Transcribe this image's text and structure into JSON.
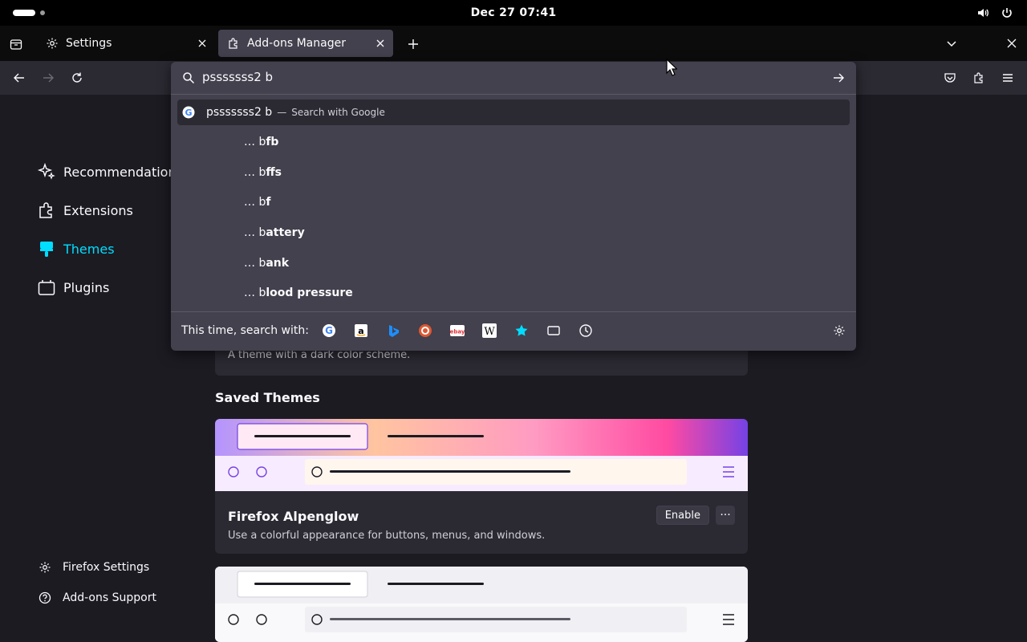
{
  "system": {
    "clock": "Dec 27  07:41",
    "icons": [
      "volume-icon",
      "power-icon"
    ]
  },
  "tabs": [
    {
      "label": "Settings",
      "icon": "gear-icon",
      "active": false
    },
    {
      "label": "Add-ons Manager",
      "icon": "puzzle-icon",
      "active": true
    }
  ],
  "urlbar": {
    "value": "psssssss2 b",
    "top_suggestion": {
      "query": "psssssss2 b",
      "separator": "—",
      "action": "Search with Google"
    },
    "suggestions": [
      {
        "prefix": "… b",
        "bold": "fb"
      },
      {
        "prefix": "… b",
        "bold": "ffs"
      },
      {
        "prefix": "… b",
        "bold": "f"
      },
      {
        "prefix": "… b",
        "bold": "attery"
      },
      {
        "prefix": "… b",
        "bold": "ank"
      },
      {
        "prefix": "… b",
        "bold": "lood pressure"
      }
    ],
    "one_off_label": "This time, search with:",
    "engines": [
      "google-icon",
      "amazon-icon",
      "bing-icon",
      "duckduckgo-icon",
      "ebay-icon",
      "wikipedia-icon",
      "bookmarks-icon",
      "tabs-icon",
      "history-icon"
    ]
  },
  "sidebar": {
    "categories": [
      {
        "label": "Recommendations",
        "icon": "sparkle-icon"
      },
      {
        "label": "Extensions",
        "icon": "puzzle-icon"
      },
      {
        "label": "Themes",
        "icon": "brush-icon",
        "selected": true
      },
      {
        "label": "Plugins",
        "icon": "plugin-icon"
      }
    ],
    "footer": [
      {
        "label": "Firefox Settings",
        "icon": "gear-icon"
      },
      {
        "label": "Add-ons Support",
        "icon": "help-icon"
      }
    ]
  },
  "main": {
    "dark_theme_desc": "A theme with a dark color scheme.",
    "saved_heading": "Saved Themes",
    "alpenglow": {
      "name": "Firefox Alpenglow",
      "desc": "Use a colorful appearance for buttons, menus, and windows.",
      "enable_label": "Enable",
      "more_label": "···"
    }
  },
  "colors": {
    "accent": "#00ddff",
    "panel": "#42414d",
    "toolbar": "#2b2a33",
    "page": "#1c1b22"
  }
}
